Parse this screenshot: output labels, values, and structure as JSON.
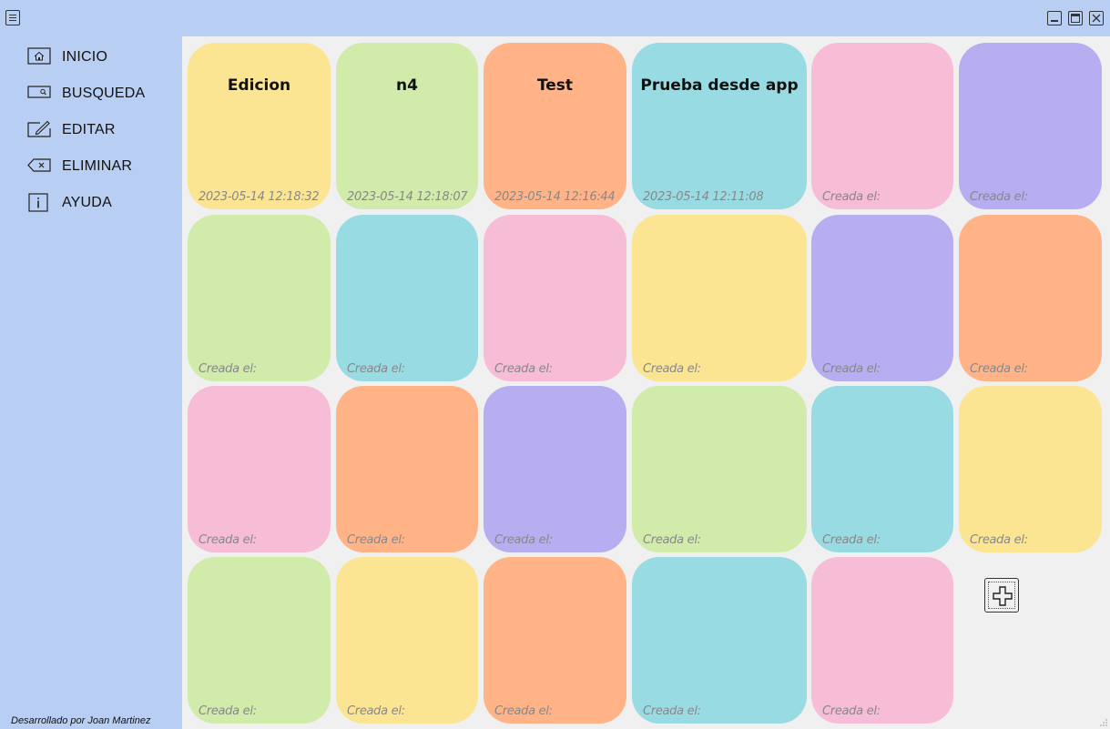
{
  "sidebar": {
    "items": [
      {
        "label": "INICIO",
        "icon": "home-icon"
      },
      {
        "label": "BUSQUEDA",
        "icon": "search-icon"
      },
      {
        "label": "EDITAR",
        "icon": "edit-icon"
      },
      {
        "label": "ELIMINAR",
        "icon": "delete-icon"
      },
      {
        "label": "AYUDA",
        "icon": "info-icon"
      }
    ],
    "footer": "Desarrollado por Joan Martinez"
  },
  "colors": {
    "yellow": "#fbe592",
    "green": "#d0ebaa",
    "orange": "#ffb387",
    "cyan": "#99dbe3",
    "pink": "#f7bcd6",
    "purple": "#b7adf1",
    "chrome": "#b8cff3",
    "background": "#f0f0f0"
  },
  "notes": [
    {
      "title": "Edicion",
      "date": "2023-05-14 12:18:32",
      "color": "yellow"
    },
    {
      "title": "n4",
      "date": "2023-05-14 12:18:07",
      "color": "green"
    },
    {
      "title": "Test",
      "date": "2023-05-14 12:16:44",
      "color": "orange"
    },
    {
      "title": "Prueba desde app",
      "date": "2023-05-14 12:11:08",
      "color": "cyan"
    },
    {
      "title": "",
      "date": "Creada el:",
      "color": "pink"
    },
    {
      "title": "",
      "date": "Creada el:",
      "color": "purple"
    },
    {
      "title": "",
      "date": "Creada el:",
      "color": "green"
    },
    {
      "title": "",
      "date": "Creada el:",
      "color": "cyan"
    },
    {
      "title": "",
      "date": "Creada el:",
      "color": "pink"
    },
    {
      "title": "",
      "date": "Creada el:",
      "color": "yellow"
    },
    {
      "title": "",
      "date": "Creada el:",
      "color": "purple"
    },
    {
      "title": "",
      "date": "Creada el:",
      "color": "orange"
    },
    {
      "title": "",
      "date": "Creada el:",
      "color": "pink"
    },
    {
      "title": "",
      "date": "Creada el:",
      "color": "orange"
    },
    {
      "title": "",
      "date": "Creada el:",
      "color": "purple"
    },
    {
      "title": "",
      "date": "Creada el:",
      "color": "green"
    },
    {
      "title": "",
      "date": "Creada el:",
      "color": "cyan"
    },
    {
      "title": "",
      "date": "Creada el:",
      "color": "yellow"
    },
    {
      "title": "",
      "date": "Creada el:",
      "color": "green"
    },
    {
      "title": "",
      "date": "Creada el:",
      "color": "yellow"
    },
    {
      "title": "",
      "date": "Creada el:",
      "color": "orange"
    },
    {
      "title": "",
      "date": "Creada el:",
      "color": "cyan"
    },
    {
      "title": "",
      "date": "Creada el:",
      "color": "pink"
    }
  ]
}
